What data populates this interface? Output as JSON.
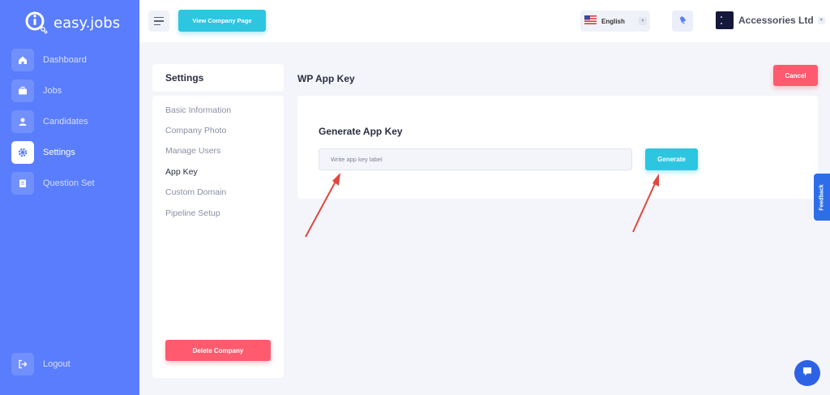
{
  "brand": {
    "name": "easy.jobs"
  },
  "sidebar": {
    "items": [
      {
        "label": "Dashboard",
        "icon": "home-icon",
        "active": false
      },
      {
        "label": "Jobs",
        "icon": "briefcase-icon",
        "active": false
      },
      {
        "label": "Candidates",
        "icon": "user-icon",
        "active": false
      },
      {
        "label": "Settings",
        "icon": "gear-icon",
        "active": true
      },
      {
        "label": "Question Set",
        "icon": "clipboard-icon",
        "active": false
      }
    ],
    "logout_label": "Logout"
  },
  "topbar": {
    "view_company_label": "View Company Page",
    "language": "English",
    "company_name": "Accessories Ltd"
  },
  "settings": {
    "title": "Settings",
    "items": [
      {
        "label": "Basic Information",
        "active": false
      },
      {
        "label": "Company Photo",
        "active": false
      },
      {
        "label": "Manage Users",
        "active": false
      },
      {
        "label": "App Key",
        "active": true
      },
      {
        "label": "Custom Domain",
        "active": false
      },
      {
        "label": "Pipeline Setup",
        "active": false
      }
    ],
    "delete_label": "Delete Company"
  },
  "main": {
    "title": "WP App Key",
    "cancel_label": "Cancel",
    "card_title": "Generate App Key",
    "input_placeholder": "Write app key label",
    "input_value": "",
    "generate_label": "Generate"
  },
  "feedback_label": "Feedback",
  "colors": {
    "sidebar": "#597dfc",
    "primary": "#2dc6e1",
    "danger": "#ff5a6e",
    "background": "#f4f5fa",
    "annotation_arrow": "#e0473e"
  }
}
